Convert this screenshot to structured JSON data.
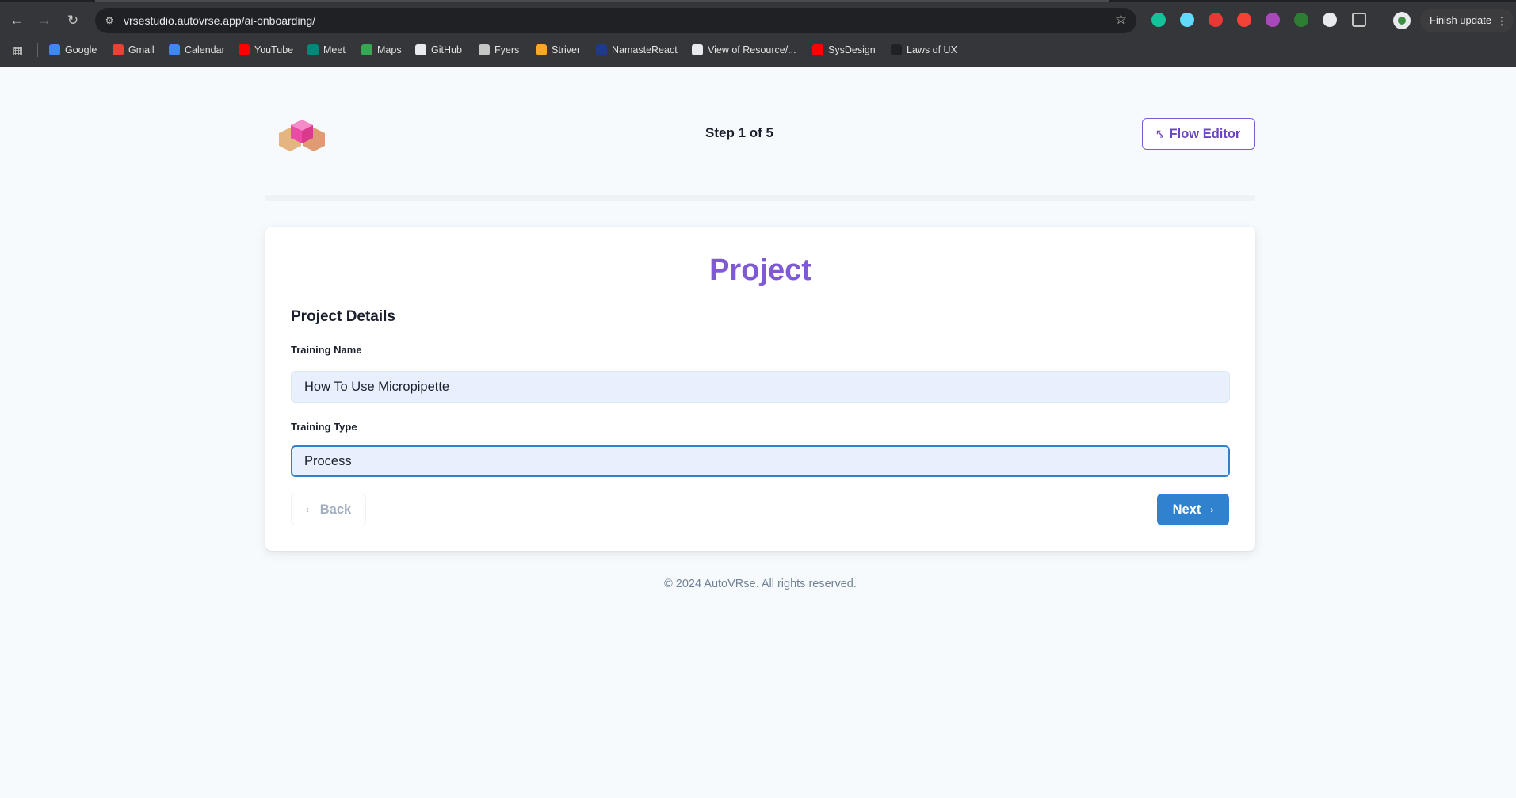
{
  "browser": {
    "url": "vrsestudio.autovrse.app/ai-onboarding/",
    "finish_update": "Finish update",
    "bookmarks": [
      {
        "label": "Google",
        "color": "#4285f4"
      },
      {
        "label": "Gmail",
        "color": "#ea4335"
      },
      {
        "label": "Calendar",
        "color": "#4285f4"
      },
      {
        "label": "YouTube",
        "color": "#ff0000"
      },
      {
        "label": "Meet",
        "color": "#00897b"
      },
      {
        "label": "Maps",
        "color": "#34a853"
      },
      {
        "label": "GitHub",
        "color": "#e8eaed"
      },
      {
        "label": "Fyers",
        "color": "#c4c7c5"
      },
      {
        "label": "Striver",
        "color": "#f9a825"
      },
      {
        "label": "NamasteReact",
        "color": "#1e3a8a"
      },
      {
        "label": "View of Resource/...",
        "color": "#e8eaed"
      },
      {
        "label": "SysDesign",
        "color": "#ff0000"
      },
      {
        "label": "Laws of UX",
        "color": "#202124"
      }
    ],
    "extensions": [
      {
        "name": "grammarly-icon",
        "color": "#15c39a"
      },
      {
        "name": "react-devtools-icon",
        "color": "#61dafb"
      },
      {
        "name": "adblock-icon",
        "color": "#e53935"
      },
      {
        "name": "red-extension-icon",
        "color": "#f44336"
      },
      {
        "name": "color-picker-icon",
        "color": "#ab47bc"
      },
      {
        "name": "green-target-icon",
        "color": "#2e7d32"
      },
      {
        "name": "compass-icon",
        "color": "#e8eaed"
      }
    ]
  },
  "header": {
    "step": "Step 1 of 5",
    "flow_editor": "Flow Editor",
    "progress": 0
  },
  "card": {
    "title": "Project",
    "section": "Project Details",
    "training_name_label": "Training Name",
    "training_name_value": "How To Use Micropipette",
    "training_type_label": "Training Type",
    "training_type_value": "Process",
    "back": "Back",
    "next": "Next"
  },
  "footer": "© 2024 AutoVRse. All rights reserved."
}
